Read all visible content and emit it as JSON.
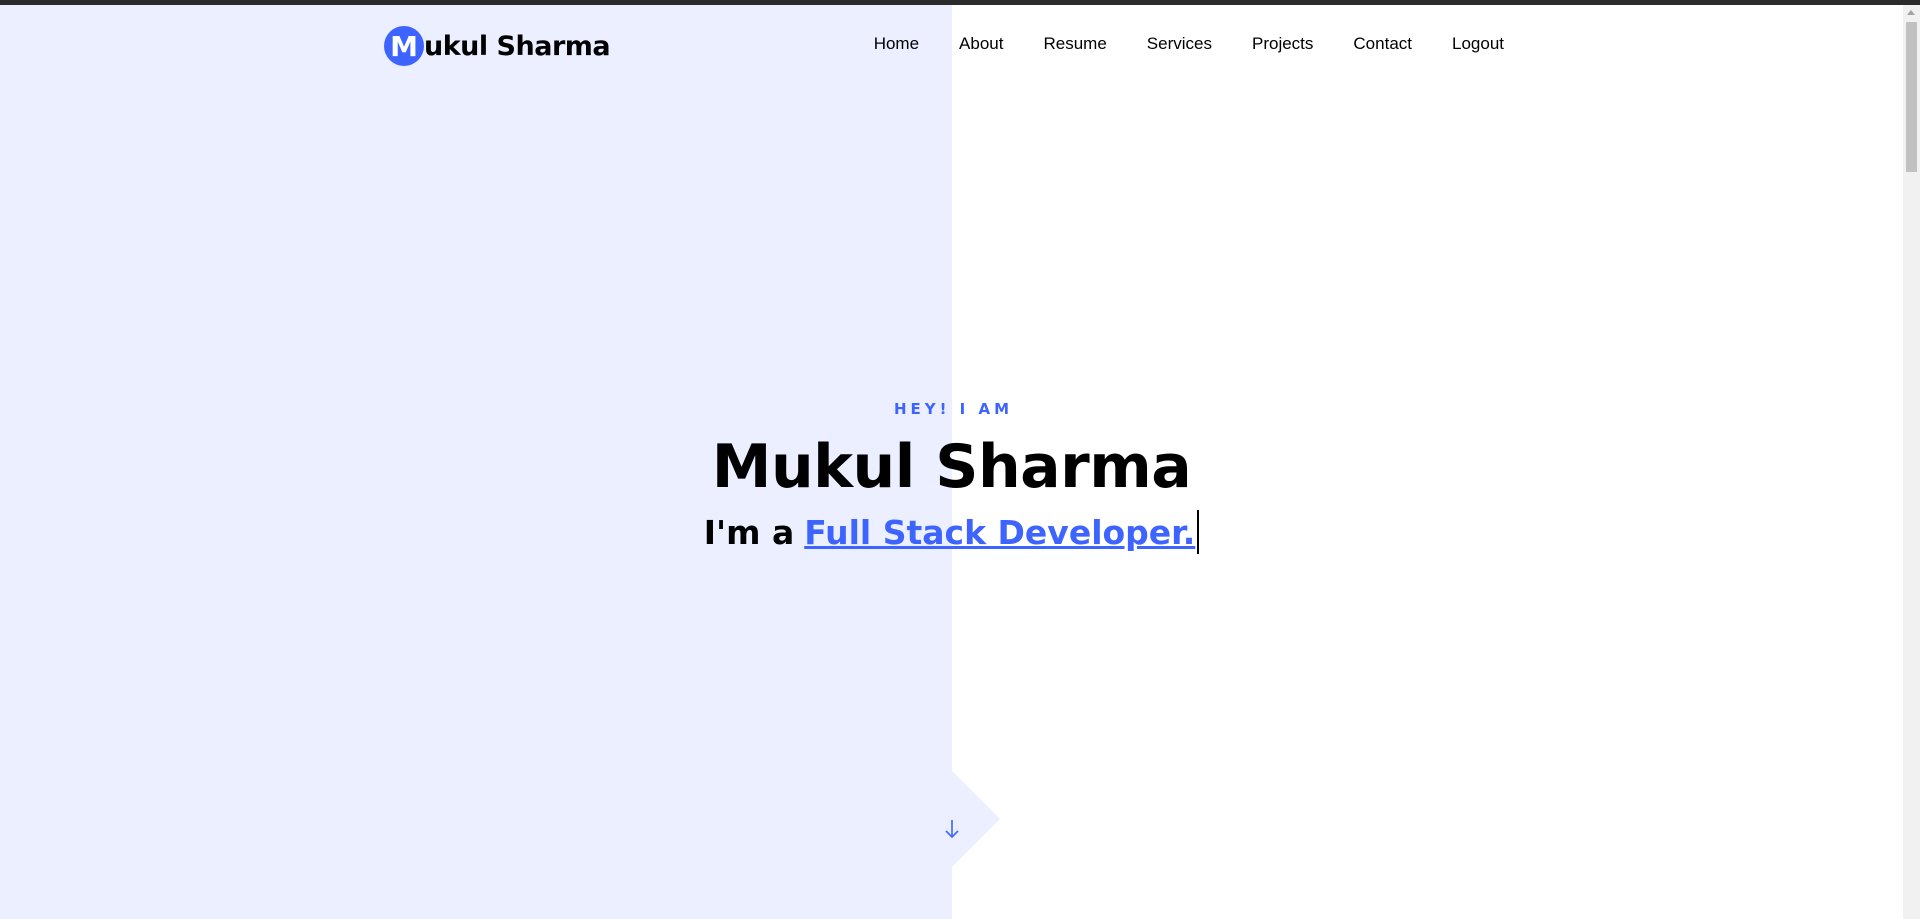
{
  "header": {
    "logo_initial": "M",
    "logo_rest": "ukul Sharma"
  },
  "nav": {
    "items": [
      {
        "label": "Home"
      },
      {
        "label": "About"
      },
      {
        "label": "Resume"
      },
      {
        "label": "Services"
      },
      {
        "label": "Projects"
      },
      {
        "label": "Contact"
      },
      {
        "label": "Logout"
      }
    ]
  },
  "hero": {
    "kicker": "HEY! I AM",
    "name": "Mukul Sharma",
    "role_prefix": "I'm a",
    "role_typed": "Full Stack Developer."
  },
  "icons": {
    "scroll_down": "arrow-down-icon"
  },
  "colors": {
    "accent": "#3e64ff",
    "left_panel": "#ebefff",
    "text": "#000000"
  }
}
